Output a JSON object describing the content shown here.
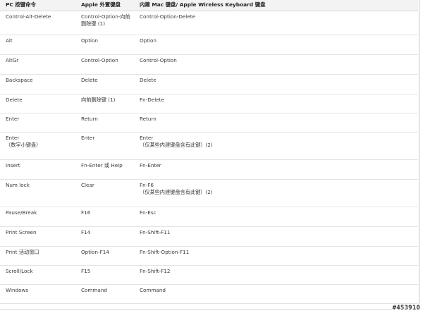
{
  "table": {
    "headers": [
      "PC 按键命令",
      "Apple 外置键盘",
      "内建  Mac 键盘/ Apple Wireless Keyboard 键盘"
    ],
    "rows": [
      {
        "pc": "Control-Alt-Delete",
        "pc2": "",
        "apple": "Control-Option-向前",
        "apple2": "删除键 (1)",
        "builtin": "Control-Option-Delete",
        "builtin2": ""
      },
      {
        "pc": "Alt",
        "pc2": "",
        "apple": "Option",
        "apple2": "",
        "builtin": "Option",
        "builtin2": ""
      },
      {
        "pc": "AltGr",
        "pc2": "",
        "apple": "Control-Option",
        "apple2": "",
        "builtin": "Control-Option",
        "builtin2": ""
      },
      {
        "pc": "Backspace",
        "pc2": "",
        "apple": "Delete",
        "apple2": "",
        "builtin": "Delete",
        "builtin2": ""
      },
      {
        "pc": "Delete",
        "pc2": "",
        "apple": "向前删除键 (1)",
        "apple2": "",
        "builtin": "Fn-Delete",
        "builtin2": ""
      },
      {
        "pc": "Enter",
        "pc2": "",
        "apple": "Return",
        "apple2": "",
        "builtin": "Return",
        "builtin2": ""
      },
      {
        "pc": "Enter",
        "pc2": "（数字小键盘）",
        "apple": "Enter",
        "apple2": "",
        "builtin": "Enter",
        "builtin2": "（仅某些内建键盘含有此键）(2)"
      },
      {
        "pc": "Insert",
        "pc2": "",
        "apple": "Fn-Enter 或 Help",
        "apple2": "",
        "builtin": "Fn-Enter",
        "builtin2": ""
      },
      {
        "pc": "Num lock",
        "pc2": "",
        "apple": "Clear",
        "apple2": "",
        "builtin": "Fn-F6",
        "builtin2": "（仅某些内建键盘含有此键）(2)"
      },
      {
        "pc": "Pause/Break",
        "pc2": "",
        "apple": "F16",
        "apple2": "",
        "builtin": "Fn-Esc",
        "builtin2": ""
      },
      {
        "pc": "Print Screen",
        "pc2": "",
        "apple": "F14",
        "apple2": "",
        "builtin": "Fn-Shift-F11",
        "builtin2": ""
      },
      {
        "pc": "Print 活动窗口",
        "pc2": "",
        "apple": "Option-F14",
        "apple2": "",
        "builtin": "Fn-Shift-Option-F11",
        "builtin2": ""
      },
      {
        "pc": "Scroll/Lock",
        "pc2": "",
        "apple": "F15",
        "apple2": "",
        "builtin": "Fn-Shift-F12",
        "builtin2": ""
      },
      {
        "pc": "Windows",
        "pc2": "",
        "apple": "Command",
        "apple2": "",
        "builtin": "Command",
        "builtin2": ""
      }
    ]
  },
  "watermark": "#453910"
}
